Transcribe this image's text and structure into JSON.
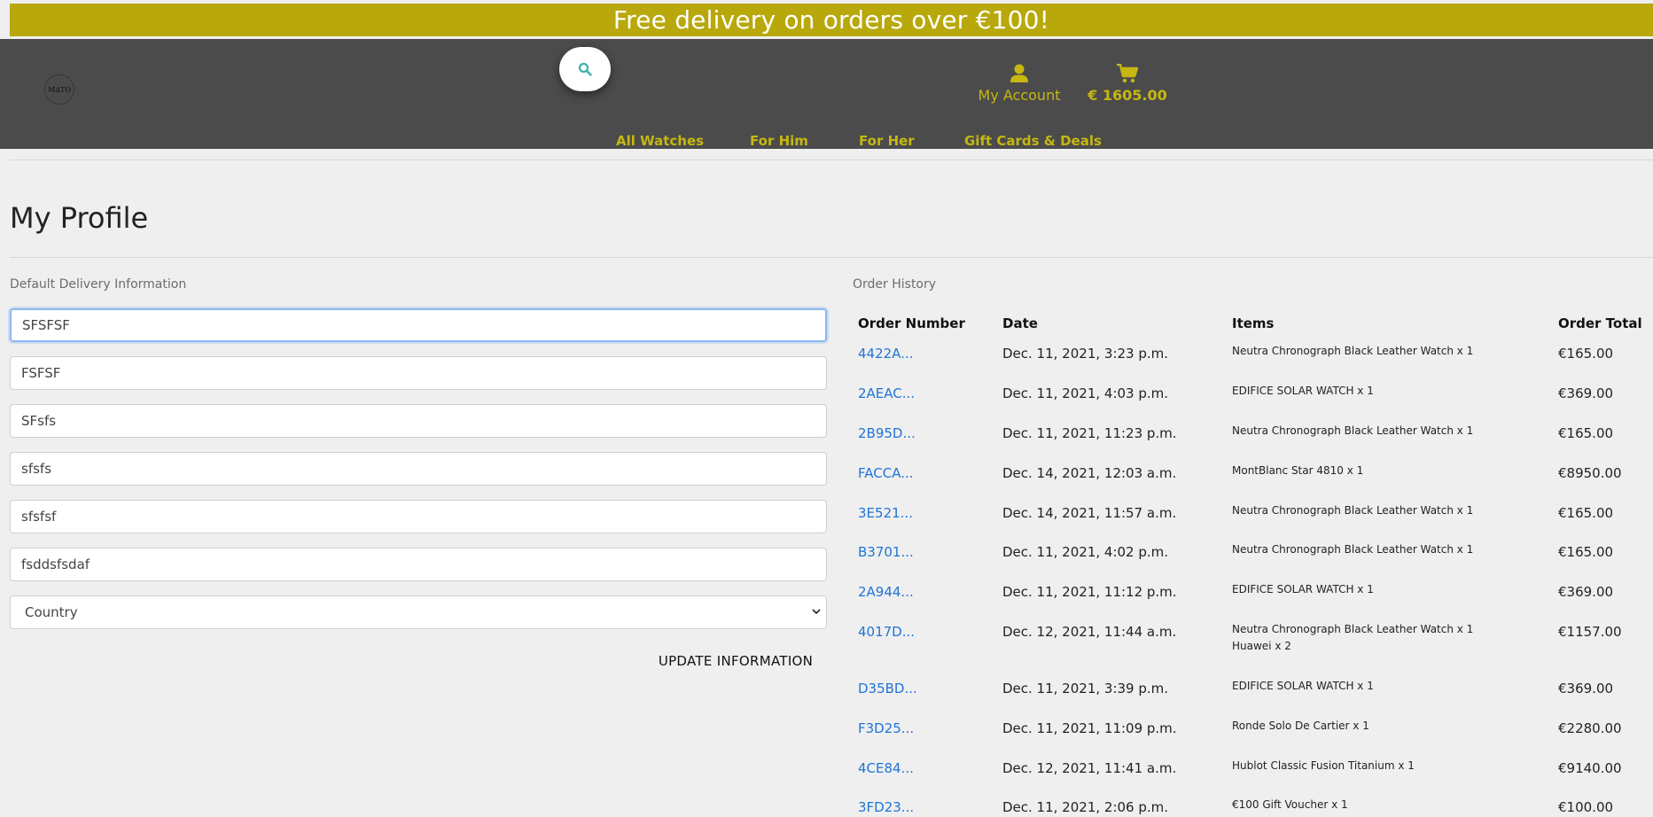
{
  "banner": {
    "text": "Free delivery on orders over €100!"
  },
  "header": {
    "logo_text": "M∆TO",
    "account_label": "My Account",
    "cart_total": "€ 1605.00",
    "nav": [
      "All Watches",
      "For Him",
      "For Her",
      "Gift Cards & Deals"
    ]
  },
  "colors": {
    "banner_bg": "#b8a80b",
    "header_bg": "#4b4b4b",
    "accent": "#c6b711",
    "link": "#1f74d6"
  },
  "page": {
    "title": "My Profile"
  },
  "delivery": {
    "heading": "Default Delivery Information",
    "fields": [
      "SFSFSF",
      "FSFSF",
      "SFsfs",
      "sfsfs",
      "sfsfsf",
      "fsddsfsdaf"
    ],
    "country_placeholder": "Country",
    "update_label": "UPDATE INFORMATION"
  },
  "orders": {
    "heading": "Order History",
    "columns": [
      "Order Number",
      "Date",
      "Items",
      "Order Total"
    ],
    "rows": [
      {
        "number": "4422A...",
        "date": "Dec. 11, 2021, 3:23 p.m.",
        "items": [
          "Neutra Chronograph Black Leather Watch x 1"
        ],
        "total": "€165.00"
      },
      {
        "number": "2AEAC...",
        "date": "Dec. 11, 2021, 4:03 p.m.",
        "items": [
          "EDIFICE SOLAR WATCH x 1"
        ],
        "total": "€369.00"
      },
      {
        "number": "2B95D...",
        "date": "Dec. 11, 2021, 11:23 p.m.",
        "items": [
          "Neutra Chronograph Black Leather Watch x 1"
        ],
        "total": "€165.00"
      },
      {
        "number": "FACCA...",
        "date": "Dec. 14, 2021, 12:03 a.m.",
        "items": [
          "MontBlanc Star 4810 x 1"
        ],
        "total": "€8950.00"
      },
      {
        "number": "3E521...",
        "date": "Dec. 14, 2021, 11:57 a.m.",
        "items": [
          "Neutra Chronograph Black Leather Watch x 1"
        ],
        "total": "€165.00"
      },
      {
        "number": "B3701...",
        "date": "Dec. 11, 2021, 4:02 p.m.",
        "items": [
          "Neutra Chronograph Black Leather Watch x 1"
        ],
        "total": "€165.00"
      },
      {
        "number": "2A944...",
        "date": "Dec. 11, 2021, 11:12 p.m.",
        "items": [
          "EDIFICE SOLAR WATCH x 1"
        ],
        "total": "€369.00"
      },
      {
        "number": "4017D...",
        "date": "Dec. 12, 2021, 11:44 a.m.",
        "items": [
          "Neutra Chronograph Black Leather Watch x 1",
          "Huawei x 2"
        ],
        "total": "€1157.00"
      },
      {
        "number": "D35BD...",
        "date": "Dec. 11, 2021, 3:39 p.m.",
        "items": [
          "EDIFICE SOLAR WATCH x 1"
        ],
        "total": "€369.00"
      },
      {
        "number": "F3D25...",
        "date": "Dec. 11, 2021, 11:09 p.m.",
        "items": [
          "Ronde Solo De Cartier x 1"
        ],
        "total": "€2280.00"
      },
      {
        "number": "4CE84...",
        "date": "Dec. 12, 2021, 11:41 a.m.",
        "items": [
          "Hublot Classic Fusion Titanium x 1"
        ],
        "total": "€9140.00"
      },
      {
        "number": "3FD23...",
        "date": "Dec. 11, 2021, 2:06 p.m.",
        "items": [
          "€100 Gift Voucher x 1"
        ],
        "total": "€100.00"
      }
    ]
  }
}
